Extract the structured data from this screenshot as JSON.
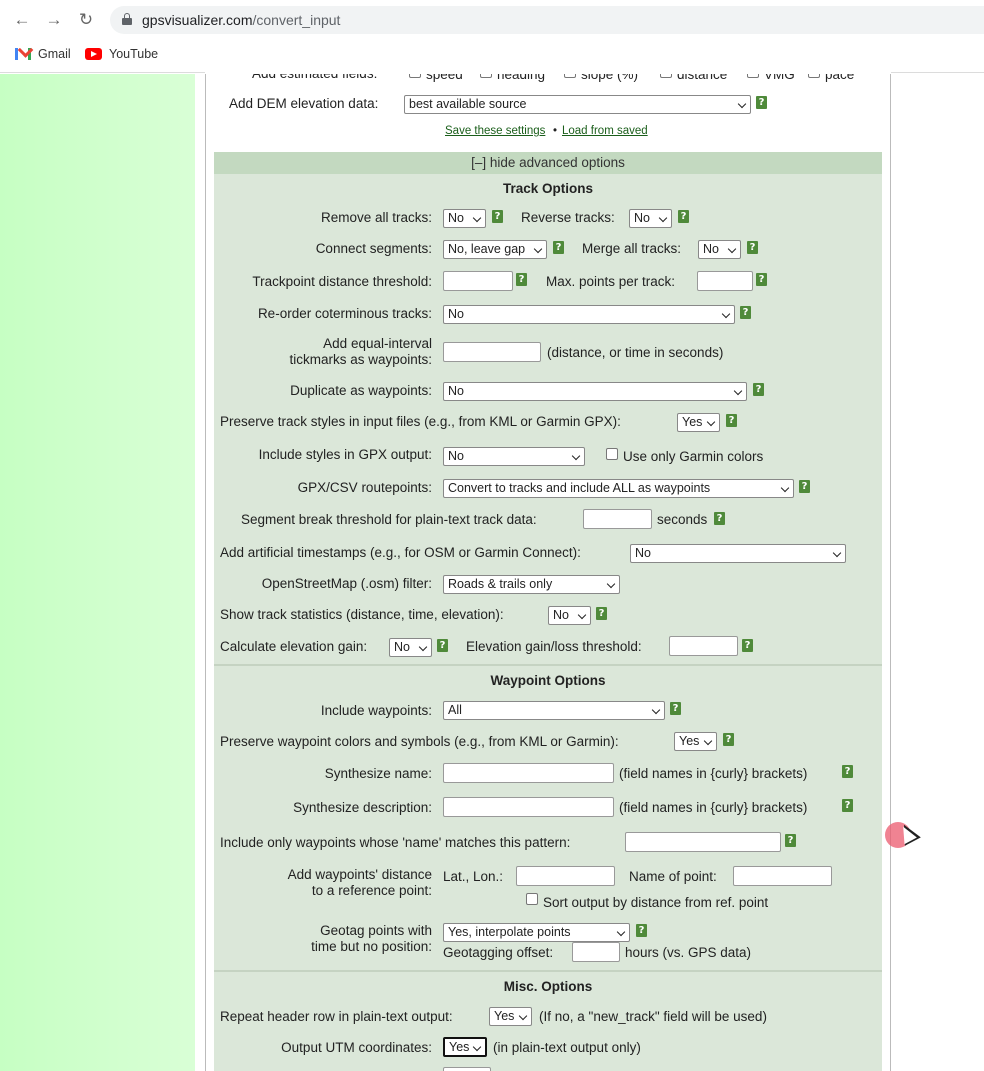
{
  "browser": {
    "url_host": "gpsvisualizer.com",
    "url_path": "/convert_input",
    "bookmarks": [
      {
        "label": "Gmail",
        "icon": "gmail-icon"
      },
      {
        "label": "YouTube",
        "icon": "youtube-icon"
      }
    ]
  },
  "top_section": {
    "estimated_fields_label": "Add estimated fields:",
    "estimated_fields": [
      "speed",
      "heading",
      "slope (%)",
      "distance",
      "VMG",
      "pace"
    ],
    "dem_label": "Add DEM elevation data:",
    "dem_value": "best available source",
    "save_link": "Save these settings",
    "load_link": "Load from saved",
    "separator": "•",
    "hide_advanced": "[–] hide advanced options"
  },
  "track": {
    "title": "Track Options",
    "remove_all_label": "Remove all tracks:",
    "remove_all_value": "No",
    "reverse_label": "Reverse tracks:",
    "reverse_value": "No",
    "connect_label": "Connect segments:",
    "connect_value": "No, leave gap",
    "merge_label": "Merge all tracks:",
    "merge_value": "No",
    "distance_threshold_label": "Trackpoint distance threshold:",
    "max_points_label": "Max. points per track:",
    "reorder_label": "Re-order coterminous tracks:",
    "reorder_value": "No",
    "tickmarks_label_1": "Add equal-interval",
    "tickmarks_label_2": "tickmarks as waypoints:",
    "tickmarks_note": "(distance, or time in seconds)",
    "duplicate_label": "Duplicate as waypoints:",
    "duplicate_value": "No",
    "preserve_styles_label": "Preserve track styles in input files (e.g., from KML or Garmin GPX):",
    "preserve_styles_value": "Yes",
    "include_styles_label": "Include styles in GPX output:",
    "include_styles_value": "No",
    "garmin_colors_label": "Use only Garmin colors",
    "routepoints_label": "GPX/CSV routepoints:",
    "routepoints_value": "Convert to tracks and include ALL as waypoints",
    "segment_break_label": "Segment break threshold for plain-text track data:",
    "segment_break_unit": "seconds",
    "timestamps_label": "Add artificial timestamps (e.g., for OSM or Garmin Connect):",
    "timestamps_value": "No",
    "osm_label": "OpenStreetMap (.osm) filter:",
    "osm_value": "Roads & trails only",
    "statistics_label": "Show track statistics (distance, time, elevation):",
    "statistics_value": "No",
    "elev_gain_label": "Calculate elevation gain:",
    "elev_gain_value": "No",
    "elev_threshold_label": "Elevation gain/loss threshold:"
  },
  "waypoint": {
    "title": "Waypoint Options",
    "include_label": "Include waypoints:",
    "include_value": "All",
    "preserve_label": "Preserve waypoint colors and symbols (e.g., from KML or Garmin):",
    "preserve_value": "Yes",
    "synth_name_label": "Synthesize name:",
    "synth_name_note": "(field names in {curly} brackets)",
    "synth_desc_label": "Synthesize description:",
    "synth_desc_note": "(field names in {curly} brackets)",
    "pattern_label": "Include only waypoints whose 'name' matches this pattern:",
    "ref_label_1": "Add waypoints' distance",
    "ref_label_2": "to a reference point:",
    "latlon_label": "Lat., Lon.:",
    "point_name_label": "Name of point:",
    "sort_label": "Sort output by distance from ref. point",
    "geotag_label_1": "Geotag points with",
    "geotag_label_2": "time but no position:",
    "geotag_value": "Yes, interpolate points",
    "offset_label": "Geotagging offset:",
    "offset_unit": "hours (vs. GPS data)"
  },
  "misc": {
    "title": "Misc. Options",
    "repeat_header_label": "Repeat header row in plain-text output:",
    "repeat_header_value": "Yes",
    "repeat_header_note": "(If no, a \"new_track\" field will be used)",
    "utm_label": "Output UTM coordinates:",
    "utm_value": "Yes",
    "utm_note": "(in plain-text output only)"
  },
  "help_glyph": "?",
  "colors": {
    "left_pane": "#c6ffc3",
    "advanced_panel": "#dbe7d9",
    "advanced_header": "#c3d9c0",
    "help_icon": "#4f8a3a",
    "link": "#1a5e1a"
  }
}
